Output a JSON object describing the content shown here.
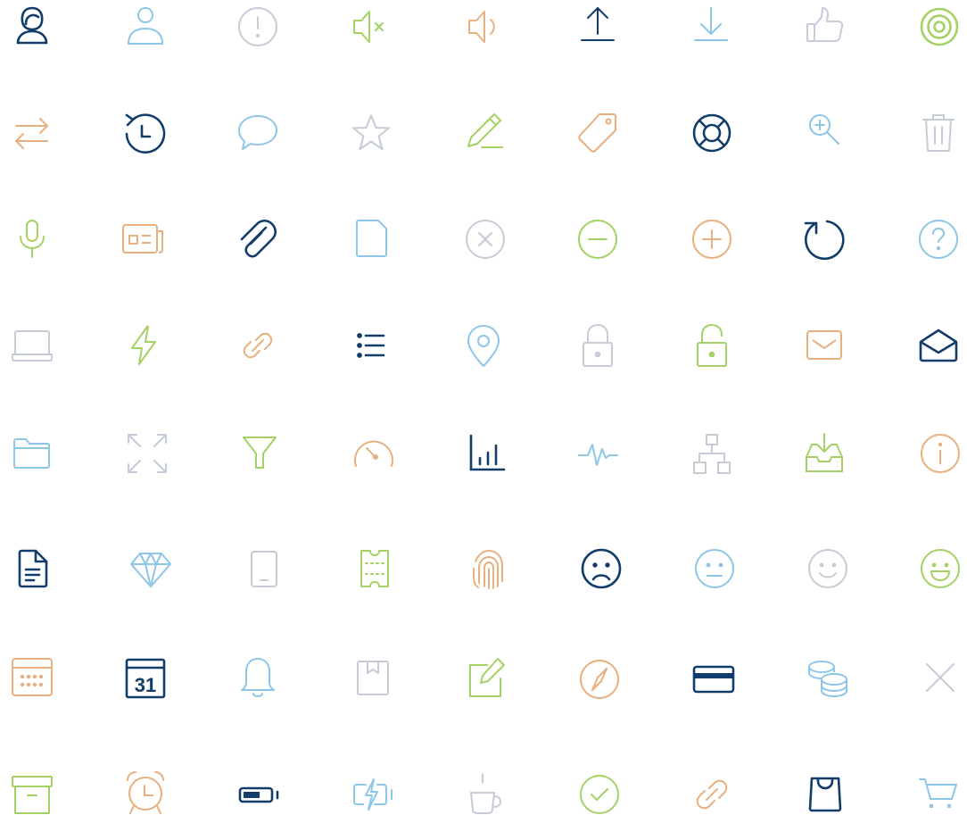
{
  "palette": {
    "navy": "#123c69",
    "sky": "#8ec6e8",
    "gray": "#c5ccd8",
    "green": "#a4d164",
    "orange": "#e8b07e"
  },
  "icons": [
    [
      "user-hijab-icon",
      "user-icon",
      "alert-circle-icon",
      "volume-mute-icon",
      "volume-up-icon",
      "upload-icon",
      "download-icon",
      "thumbs-up-icon",
      "target-icon"
    ],
    [
      "swap-arrows-icon",
      "history-icon",
      "chat-bubble-icon",
      "star-icon",
      "pencil-icon",
      "tag-icon",
      "lifebuoy-icon",
      "zoom-in-icon",
      "trash-icon"
    ],
    [
      "microphone-icon",
      "newspaper-icon",
      "paperclip-icon",
      "file-icon",
      "close-circle-icon",
      "minus-circle-icon",
      "plus-circle-icon",
      "refresh-icon",
      "help-circle-icon"
    ],
    [
      "laptop-icon",
      "lightning-icon",
      "link-diagonal-icon",
      "list-icon",
      "map-pin-icon",
      "lock-icon",
      "unlock-icon",
      "mail-icon",
      "mail-open-icon"
    ],
    [
      "folder-icon",
      "expand-icon",
      "filter-icon",
      "speedometer-icon",
      "bar-chart-icon",
      "pulse-icon",
      "sitemap-icon",
      "inbox-download-icon",
      "info-circle-icon"
    ],
    [
      "document-text-icon",
      "diamond-icon",
      "tablet-icon",
      "ticket-icon",
      "fingerprint-icon",
      "sad-face-icon",
      "neutral-face-icon",
      "smile-face-icon",
      "happy-face-icon"
    ],
    [
      "calendar-grid-icon",
      "calendar-date-icon",
      "bell-icon",
      "bookmark-box-icon",
      "edit-square-icon",
      "compass-icon",
      "credit-card-icon",
      "coins-icon",
      "close-icon"
    ],
    [
      "archive-box-icon",
      "alarm-clock-icon",
      "battery-icon",
      "battery-charging-icon",
      "coffee-cup-icon",
      "check-circle-icon",
      "link-chain-icon",
      "shopping-bag-icon",
      "shopping-cart-icon"
    ]
  ],
  "colors": [
    [
      "navy",
      "sky",
      "gray",
      "green",
      "orange",
      "navy",
      "sky",
      "gray",
      "green"
    ],
    [
      "orange",
      "navy",
      "sky",
      "gray",
      "green",
      "orange",
      "navy",
      "sky",
      "gray"
    ],
    [
      "green",
      "orange",
      "navy",
      "sky",
      "gray",
      "green",
      "orange",
      "navy",
      "sky"
    ],
    [
      "gray",
      "green",
      "orange",
      "navy",
      "sky",
      "gray",
      "green",
      "orange",
      "navy"
    ],
    [
      "sky",
      "gray",
      "green",
      "orange",
      "navy",
      "sky",
      "gray",
      "green",
      "orange"
    ],
    [
      "navy",
      "sky",
      "gray",
      "green",
      "orange",
      "navy",
      "sky",
      "gray",
      "green"
    ],
    [
      "orange",
      "navy",
      "sky",
      "gray",
      "green",
      "orange",
      "navy",
      "sky",
      "gray"
    ],
    [
      "green",
      "orange",
      "navy",
      "sky",
      "gray",
      "green",
      "orange",
      "navy",
      "sky"
    ]
  ],
  "calendar_day": "31"
}
